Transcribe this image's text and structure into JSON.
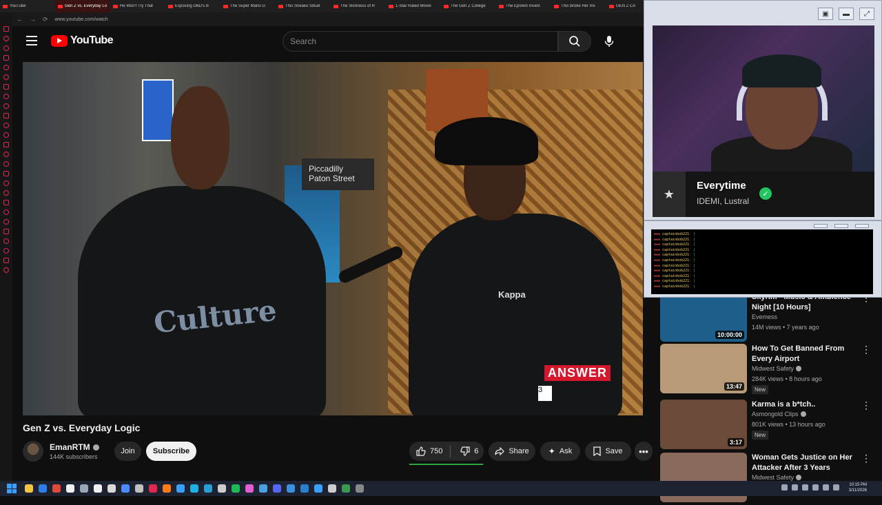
{
  "browser": {
    "tabs": [
      {
        "label": "YouTube",
        "active": false
      },
      {
        "label": "Gen Z vs. Everyday Lo",
        "active": true
      },
      {
        "label": "He Won't Try That",
        "active": false
      },
      {
        "label": "Exposing DBD's B",
        "active": false
      },
      {
        "label": "The Super Mario G",
        "active": false
      },
      {
        "label": "This Sneako Situat",
        "active": false
      },
      {
        "label": "The Slickness of R",
        "active": false
      },
      {
        "label": "1-Star Rated Movie",
        "active": false
      },
      {
        "label": "The Gen Z College",
        "active": false
      },
      {
        "label": "The Epstein Invest",
        "active": false
      },
      {
        "label": "This Broke Her Ins",
        "active": false
      },
      {
        "label": "GEN Z CA",
        "active": false
      }
    ],
    "url": "www.youtube.com/watch"
  },
  "masthead": {
    "logo_text": "YouTube",
    "search_placeholder": "Search"
  },
  "video": {
    "title": "Gen Z vs. Everyday Logic",
    "overlay_sign": "Piccadilly\nPaton Street",
    "jacket_text_left": "Culture",
    "jacket_text_right": "Kappa",
    "answer_badge": "ANSWER",
    "answer_tag": "3"
  },
  "channel": {
    "name": "EmanRTM",
    "subscribers": "144K subscribers",
    "join_label": "Join",
    "subscribe_label": "Subscribe"
  },
  "actions": {
    "likes": "750",
    "dislikes": "6",
    "like_ratio": 0.99,
    "share_label": "Share",
    "ask_label": "Ask",
    "save_label": "Save"
  },
  "stream_overlay": {
    "now_playing_title": "Everytime",
    "now_playing_artist": "IDEMI, Lustral",
    "chat_lines": [
      {
        "user": "captainbob221",
        "msg": "|"
      },
      {
        "user": "captainbob221",
        "msg": "|"
      },
      {
        "user": "captainbob221",
        "msg": "|"
      },
      {
        "user": "captainbob221",
        "msg": "|"
      },
      {
        "user": "captainbob221",
        "msg": "|"
      },
      {
        "user": "captainbob221",
        "msg": "|"
      },
      {
        "user": "captainbob221",
        "msg": "|"
      },
      {
        "user": "captainbob221",
        "msg": "|"
      },
      {
        "user": "captainbob221",
        "msg": "|"
      },
      {
        "user": "captainbob221",
        "msg": "|"
      },
      {
        "user": "captainbob221",
        "msg": "|"
      }
    ]
  },
  "recommendations": [
    {
      "title": "Skyrim - Music & Ambience Night [10 Hours]",
      "channel": "Evemess",
      "verified": false,
      "meta": "14M views • 7 years ago",
      "duration": "10:00:00",
      "is_new": false,
      "thumb_color": "#1d5f8a"
    },
    {
      "title": "How To Get Banned From Every Airport",
      "channel": "Midwest Safety",
      "verified": true,
      "meta": "284K views • 8 hours ago",
      "duration": "13:47",
      "is_new": true,
      "thumb_color": "#b89a78"
    },
    {
      "title": "Karma is a b*tch..",
      "channel": "Asmongold Clips",
      "verified": true,
      "meta": "801K views • 13 hours ago",
      "duration": "3:17",
      "is_new": true,
      "thumb_color": "#6b4a3a"
    },
    {
      "title": "Woman Gets Justice on Her Attacker After 3 Years",
      "channel": "Midwest Safety",
      "verified": true,
      "meta": "",
      "duration": "",
      "is_new": false,
      "thumb_color": "#8a6a5a"
    }
  ],
  "new_badge": "New",
  "taskbar": {
    "time": "10:15 PM",
    "date": "3/11/2026"
  }
}
